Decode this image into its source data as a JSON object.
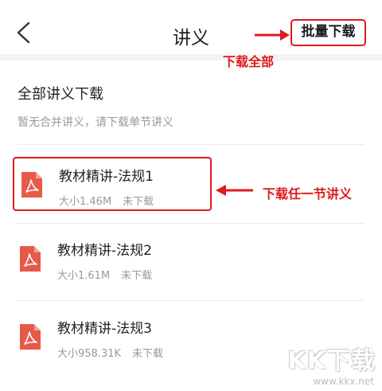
{
  "header": {
    "title": "讲义",
    "batch_download_label": "批量下载"
  },
  "annotations": {
    "batch_note": "下载全部",
    "item_note": "下载任一节讲义"
  },
  "all_download": {
    "title": "全部讲义下载",
    "subtitle": "暂无合并讲义，请下载单节讲义"
  },
  "items": [
    {
      "name": "教材精讲-法规1",
      "size": "大小1.46M",
      "status": "未下载"
    },
    {
      "name": "教材精讲-法规2",
      "size": "大小1.61M",
      "status": "未下载"
    },
    {
      "name": "教材精讲-法规3",
      "size": "大小958.31K",
      "status": "未下载"
    }
  ],
  "watermark": {
    "text": "KK下载",
    "url": "www.kkx.net"
  },
  "colors": {
    "accent_red": "#e0191c",
    "pdf_red": "#e65a4a",
    "text_primary": "#222222",
    "text_secondary": "#999999"
  }
}
